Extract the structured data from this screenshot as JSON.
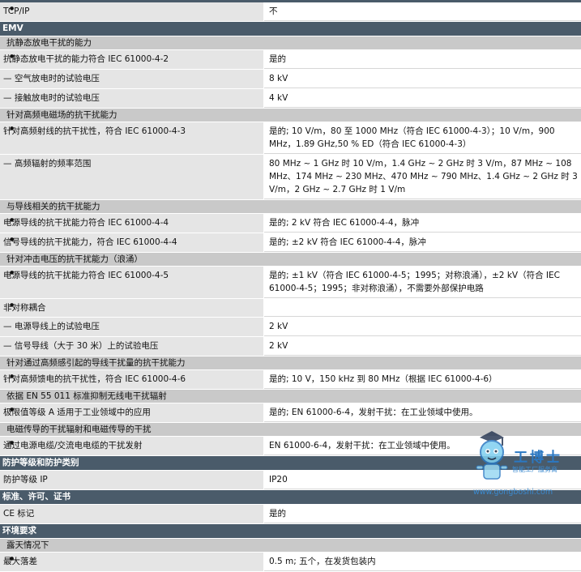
{
  "rows": [
    {
      "type": "data",
      "level": 1,
      "label": "TCP/IP",
      "value": "不",
      "h": 16
    },
    {
      "type": "cat",
      "label": "EMV"
    },
    {
      "type": "sub",
      "label": "抗静态放电干扰的能力"
    },
    {
      "type": "data",
      "level": 1,
      "label": "抗静态放电干扰的能力符合 IEC 61000-4-2",
      "value": "是的"
    },
    {
      "type": "data",
      "level": 2,
      "label": "— 空气放电时的试验电压",
      "value": "8 kV"
    },
    {
      "type": "data",
      "level": 2,
      "label": "— 接触放电时的试验电压",
      "value": "4 kV"
    },
    {
      "type": "sub",
      "label": "针对高频电磁场的抗干扰能力"
    },
    {
      "type": "data",
      "level": 1,
      "label": "针对高频射线的抗干扰性，符合 IEC 61000-4-3",
      "value": "是的; 10 V/m，80 至 1000 MHz（符合 IEC 61000-4-3）；10 V/m，900 MHz，1.89 GHz,50 % ED（符合 IEC 61000-4-3）"
    },
    {
      "type": "data",
      "level": 2,
      "label": "— 高频辐射的频率范围",
      "value": "80 MHz ~ 1 GHz 时 10 V/m，1.4 GHz ~ 2 GHz 时 3 V/m，87 MHz ~ 108 MHz、174 MHz ~ 230 MHz、470 MHz ~ 790 MHz、1.4 GHz ~ 2 GHz 时 3 V/m，2 GHz ~ 2.7 GHz 时 1 V/m"
    },
    {
      "type": "sub",
      "label": "与导线相关的抗干扰能力"
    },
    {
      "type": "data",
      "level": 1,
      "label": "电源导线的抗干扰能力符合 IEC 61000-4-4",
      "value": "是的; 2 kV 符合 IEC 61000-4-4，脉冲"
    },
    {
      "type": "data",
      "level": 1,
      "label": "信号导线的抗干扰能力，符合 IEC 61000-4-4",
      "value": "是的; ±2 kV 符合 IEC 61000-4-4，脉冲"
    },
    {
      "type": "sub",
      "label": "针对冲击电压的抗干扰能力（浪涌）"
    },
    {
      "type": "data",
      "level": 1,
      "label": "电源导线的抗干扰能力符合 IEC 61000-4-5",
      "value": "是的; ±1 kV（符合 IEC 61000-4-5；1995；对称浪涌），±2 kV（符合 IEC 61000-4-5；1995；非对称浪涌），不需要外部保护电路"
    },
    {
      "type": "data",
      "level": 1,
      "label": "非对称耦合",
      "value": ""
    },
    {
      "type": "data",
      "level": 2,
      "label": "— 电源导线上的试验电压",
      "value": "2 kV"
    },
    {
      "type": "data",
      "level": 2,
      "label": "— 信号导线（大于 30 米）上的试验电压",
      "value": "2 kV"
    },
    {
      "type": "sub",
      "label": "针对通过高频感引起的导线干扰量的抗干扰能力"
    },
    {
      "type": "data",
      "level": 1,
      "label": "针对高频馈电的抗干扰性，符合 IEC 61000-4-6",
      "value": "是的; 10 V，150 kHz 到 80 MHz（根据 IEC 61000-4-6）"
    },
    {
      "type": "sub",
      "label": "依据 EN 55 011 标准抑制无线电干扰辐射"
    },
    {
      "type": "data",
      "level": 1,
      "label": "极限值等级 A 适用于工业领域中的应用",
      "value": "是的; EN 61000-6-4，发射干扰：在工业领域中使用。"
    },
    {
      "type": "sub",
      "label": "电磁传导的干扰辐射和电磁传导的干扰"
    },
    {
      "type": "data",
      "level": 1,
      "label": "通过电源电缆/交流电电缆的干扰发射",
      "value": "EN 61000-6-4，发射干扰：在工业领域中使用。"
    },
    {
      "type": "cat",
      "label": "防护等级和防护类别"
    },
    {
      "type": "data",
      "level": 0,
      "label": "防护等级 IP",
      "value": "IP20"
    },
    {
      "type": "cat",
      "label": "标准、许可、证书"
    },
    {
      "type": "data",
      "level": 0,
      "label": "CE 标记",
      "value": "是的"
    },
    {
      "type": "cat",
      "label": "环境要求"
    },
    {
      "type": "sub",
      "label": "露天情况下"
    },
    {
      "type": "data",
      "level": 1,
      "label": "最大落差",
      "value": "0.5 m; 五个，在发货包装内"
    }
  ],
  "watermark": {
    "title": "工博士",
    "subtitle": "智能工厂服务商",
    "url": "www.gongboshi.com",
    "colors": {
      "blue": "#2b78c2",
      "face": "#7fd0f0"
    }
  },
  "colors": {
    "category": "#4a5b6a",
    "subsection": "#c9c9c9",
    "label_bg": "#e5e5e5"
  }
}
